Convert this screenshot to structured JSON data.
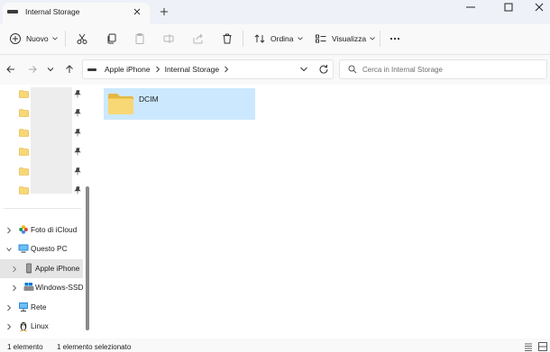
{
  "tab": {
    "title": "Internal Storage"
  },
  "toolbar": {
    "new_label": "Nuovo",
    "sort_label": "Ordina",
    "view_label": "Visualizza"
  },
  "breadcrumb": {
    "items": [
      "Apple iPhone",
      "Internal Storage"
    ]
  },
  "search": {
    "placeholder": "Cerca in Internal Storage"
  },
  "sidebar": {
    "items": [
      {
        "label": "Foto di iCloud",
        "icon": "icloud-photos-icon"
      },
      {
        "label": "Questo PC",
        "icon": "this-pc-icon"
      },
      {
        "label": "Apple iPhone",
        "icon": "iphone-icon",
        "selected": true
      },
      {
        "label": "Windows-SSD",
        "icon": "drive-icon"
      },
      {
        "label": "Rete",
        "icon": "network-icon"
      },
      {
        "label": "Linux",
        "icon": "linux-icon"
      }
    ]
  },
  "content": {
    "items": [
      {
        "name": "DCIM",
        "type": "folder",
        "selected": true
      }
    ]
  },
  "status": {
    "count": "1 elemento",
    "selected": "1 elemento selezionato"
  },
  "colors": {
    "selection": "#cce8ff",
    "folder": "#f8d775",
    "accent": "#0067c0"
  }
}
